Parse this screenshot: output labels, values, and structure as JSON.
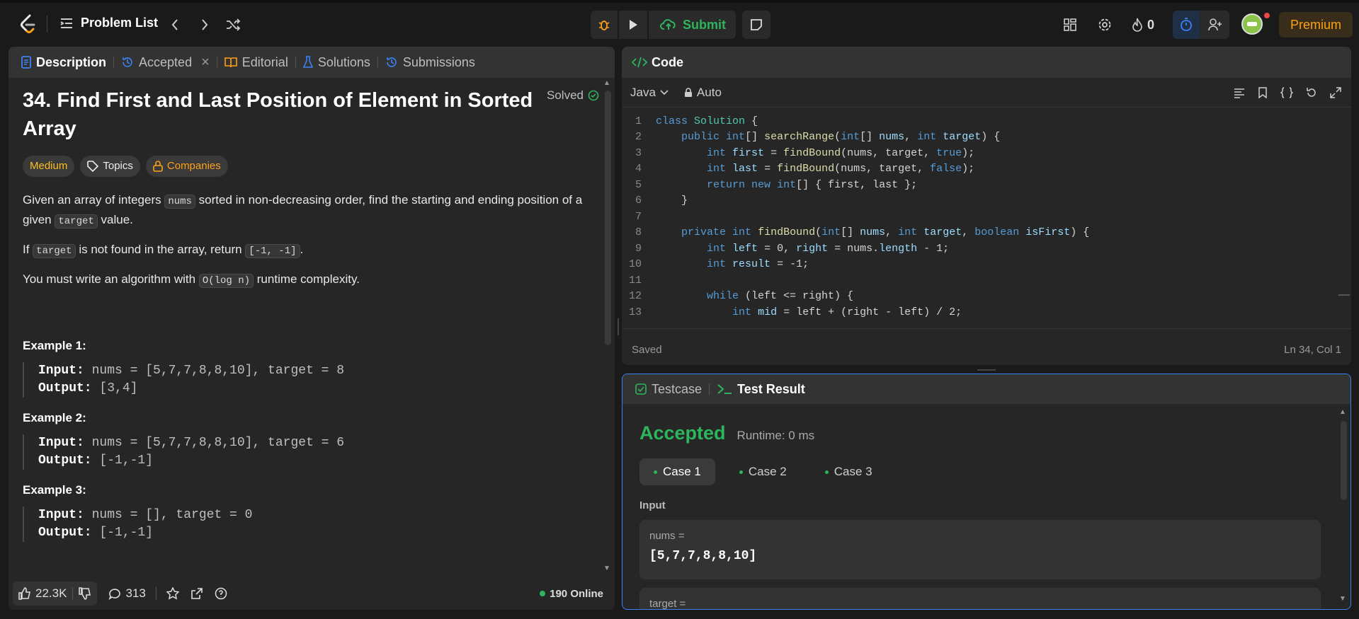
{
  "topbar": {
    "problem_list": "Problem List",
    "submit": "Submit",
    "streak": "0",
    "premium": "Premium"
  },
  "left_tabs": [
    {
      "label": "Description"
    },
    {
      "label": "Accepted"
    },
    {
      "label": "Editorial"
    },
    {
      "label": "Solutions"
    },
    {
      "label": "Submissions"
    }
  ],
  "problem": {
    "title": "34. Find First and Last Position of Element in Sorted Array",
    "status": "Solved",
    "difficulty": "Medium",
    "topics": "Topics",
    "companies": "Companies",
    "p1_a": "Given an array of integers ",
    "p1_code1": "nums",
    "p1_b": " sorted in non-decreasing order, find the starting and ending position of a given ",
    "p1_code2": "target",
    "p1_c": " value.",
    "p2_a": "If ",
    "p2_code1": "target",
    "p2_b": " is not found in the array, return ",
    "p2_code2": "[-1, -1]",
    "p2_c": ".",
    "p3_a": "You must write an algorithm with ",
    "p3_code": "O(log n)",
    "p3_b": " runtime complexity.",
    "examples": [
      {
        "heading": "Example 1:",
        "input_label": "Input:",
        "input": " nums = [5,7,7,8,8,10], target = 8",
        "output_label": "Output:",
        "output": " [3,4]"
      },
      {
        "heading": "Example 2:",
        "input_label": "Input:",
        "input": " nums = [5,7,7,8,8,10], target = 6",
        "output_label": "Output:",
        "output": " [-1,-1]"
      },
      {
        "heading": "Example 3:",
        "input_label": "Input:",
        "input": " nums = [], target = 0",
        "output_label": "Output:",
        "output": " [-1,-1]"
      }
    ]
  },
  "footer": {
    "likes": "22.3K",
    "comments": "313",
    "online": "190 Online"
  },
  "code_panel": {
    "title": "Code",
    "language": "Java",
    "mode": "Auto",
    "saved": "Saved",
    "cursor": "Ln 34, Col 1"
  },
  "code_lines": [
    {
      "n": "1",
      "t": "class Solution {"
    },
    {
      "n": "2",
      "t": "    public int[] searchRange(int[] nums, int target) {"
    },
    {
      "n": "3",
      "t": "        int first = findBound(nums, target, true);"
    },
    {
      "n": "4",
      "t": "        int last = findBound(nums, target, false);"
    },
    {
      "n": "5",
      "t": "        return new int[] { first, last };"
    },
    {
      "n": "6",
      "t": "    }"
    },
    {
      "n": "7",
      "t": ""
    },
    {
      "n": "8",
      "t": "    private int findBound(int[] nums, int target, boolean isFirst) {"
    },
    {
      "n": "9",
      "t": "        int left = 0, right = nums.length - 1;"
    },
    {
      "n": "10",
      "t": "        int result = -1;"
    },
    {
      "n": "11",
      "t": ""
    },
    {
      "n": "12",
      "t": "        while (left <= right) {"
    },
    {
      "n": "13",
      "t": "            int mid = left + (right - left) / 2;"
    }
  ],
  "result_panel": {
    "tab_testcase": "Testcase",
    "tab_result": "Test Result",
    "verdict": "Accepted",
    "runtime": "Runtime: 0 ms",
    "cases": [
      "Case 1",
      "Case 2",
      "Case 3"
    ],
    "input_label": "Input",
    "var1_name": "nums =",
    "var1_value": "[5,7,7,8,8,10]",
    "var2_name": "target ="
  },
  "colors": {
    "accent_orange": "#ffa116",
    "success_green": "#2db55d",
    "medium_yellow": "#ffc01e",
    "link_blue": "#3b82f6"
  }
}
